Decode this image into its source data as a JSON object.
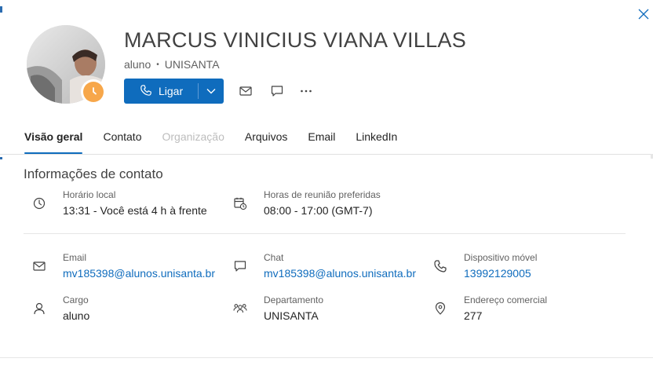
{
  "contact": {
    "name": "MARCUS VINICIUS VIANA VILLAS",
    "role": "aluno",
    "separator": "•",
    "organization": "UNISANTA",
    "presence_status": "away"
  },
  "actions": {
    "call_label": "Ligar"
  },
  "tabs": [
    {
      "label": "Visão geral",
      "state": "active"
    },
    {
      "label": "Contato",
      "state": "normal"
    },
    {
      "label": "Organização",
      "state": "disabled"
    },
    {
      "label": "Arquivos",
      "state": "normal"
    },
    {
      "label": "Email",
      "state": "normal"
    },
    {
      "label": "LinkedIn",
      "state": "normal"
    }
  ],
  "section_title": "Informações de contato",
  "fields": {
    "local_time": {
      "label": "Horário local",
      "value": "13:31 - Você está 4 h à frente",
      "icon": "clock-icon"
    },
    "meeting_hours": {
      "label": "Horas de reunião preferidas",
      "value": "08:00 - 17:00 (GMT-7)",
      "icon": "calendar-clock-icon"
    },
    "email": {
      "label": "Email",
      "value": "mv185398@alunos.unisanta.br",
      "icon": "mail-icon"
    },
    "chat": {
      "label": "Chat",
      "value": "mv185398@alunos.unisanta.br",
      "icon": "chat-icon"
    },
    "mobile": {
      "label": "Dispositivo móvel",
      "value": "13992129005",
      "icon": "phone-icon"
    },
    "job_title": {
      "label": "Cargo",
      "value": "aluno",
      "icon": "person-icon"
    },
    "department": {
      "label": "Departamento",
      "value": "UNISANTA",
      "icon": "people-team-icon"
    },
    "office_address": {
      "label": "Endereço comercial",
      "value": "277",
      "icon": "location-icon"
    }
  },
  "colors": {
    "accent": "#0f6cbd",
    "presence_away": "#f7a74a",
    "text_primary": "#242424",
    "text_secondary": "#616161"
  }
}
